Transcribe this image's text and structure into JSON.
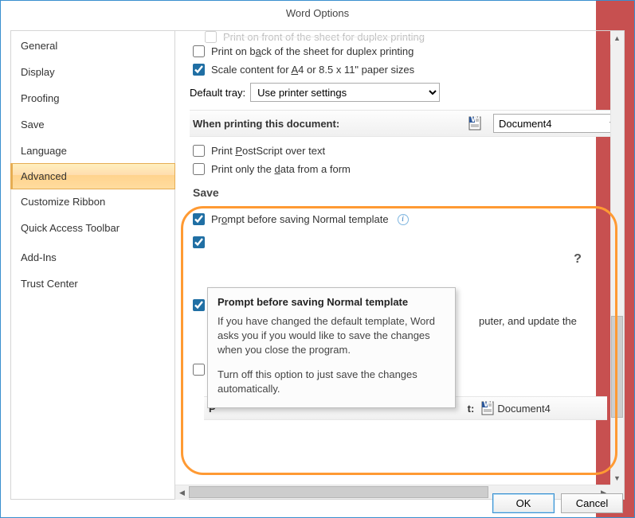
{
  "title": "Word Options",
  "sidebar": {
    "items": [
      {
        "label": "General"
      },
      {
        "label": "Display"
      },
      {
        "label": "Proofing"
      },
      {
        "label": "Save"
      },
      {
        "label": "Language"
      },
      {
        "label": "Advanced",
        "active": true
      },
      {
        "label": "Customize Ribbon"
      },
      {
        "label": "Quick Access Toolbar"
      },
      {
        "label": "Add-Ins"
      },
      {
        "label": "Trust Center"
      }
    ]
  },
  "options": {
    "cutoff_top": "Print on front of the sheet for duplex printing",
    "back_duplex": "Print on back of the sheet for duplex printing",
    "scale": "Scale content for A4 or 8.5 x 11\" paper sizes",
    "scale_checked": true,
    "default_tray_label": "Default tray:",
    "default_tray_value": "Use printer settings",
    "when_printing_label": "When printing this document:",
    "when_printing_doc": "Document4",
    "postscript": "Print PostScript over text",
    "data_form": "Print only the data from a form",
    "save_header": "Save",
    "prompt_normal": "Prompt before saving Normal template",
    "prompt_normal_checked": true,
    "behind_text": "puter, and update the",
    "preserve_prefix": "P",
    "preserve_suffix": "t:",
    "preserve_doc": "Document4"
  },
  "tooltip": {
    "title": "Prompt before saving Normal template",
    "p1": "If you have changed the default template, Word asks you if you would like to save the changes when you close the program.",
    "p2": "Turn off this option to just save the changes automatically."
  },
  "buttons": {
    "ok": "OK",
    "cancel": "Cancel"
  }
}
